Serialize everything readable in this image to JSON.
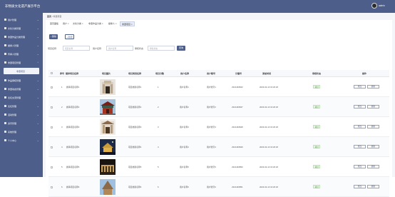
{
  "header": {
    "app_title": "非物质文化遗产展示平台",
    "username": "admin"
  },
  "sidebar": {
    "items": [
      {
        "label": "用户管理"
      },
      {
        "label": "文化分类管理"
      },
      {
        "label": "非遗作品分类管理"
      },
      {
        "label": "继承人管理"
      },
      {
        "label": "传承人管理"
      },
      {
        "label": "非遗项目管理"
      },
      {
        "label": "作品审核管理"
      },
      {
        "label": "非遗动态管理"
      },
      {
        "label": "论坛交流管理"
      },
      {
        "label": "论坛管理"
      },
      {
        "label": "活动管理"
      },
      {
        "label": "资讯管理"
      },
      {
        "label": "系统管理"
      },
      {
        "label": "个人中心"
      }
    ],
    "active_sub": "非遗项目"
  },
  "breadcrumb": {
    "home": "首页",
    "current": "非遗项目"
  },
  "tabs": [
    {
      "label": "首页面板"
    },
    {
      "label": "用户 ×"
    },
    {
      "label": "文化分类 ×"
    },
    {
      "label": "非遗作品分类 ×"
    },
    {
      "label": "继承人 ×"
    },
    {
      "label": "非遗项目 ×"
    }
  ],
  "toolbar": {
    "delete_label": "删除",
    "add_label": "新增"
  },
  "filters": {
    "name_label": "项目名称",
    "name_placeholder": "项目名称",
    "user_label": "用户名称",
    "user_placeholder": "用户名称",
    "status_label": "审核状态",
    "status_placeholder": "审核状态",
    "search_label": "查询"
  },
  "table": {
    "headers": [
      "序号",
      "继承项目名称",
      "项目图片",
      "项目类别名称",
      "项目分数",
      "用户名称",
      "用户账号",
      "分值号",
      "添加时间",
      "审核状态",
      "操作"
    ],
    "rows": [
      {
        "idx": "1",
        "name": "继承项目名称1",
        "category": "项目类别名称1",
        "score": "1",
        "user": "用户名称1",
        "account": "用户账号1",
        "code": "2321446843",
        "time": "2023-04-13 16:20:18",
        "status": "通过"
      },
      {
        "idx": "2",
        "name": "继承项目名称2",
        "category": "项目类别名称2",
        "score": "2",
        "user": "用户名称2",
        "account": "用户账号2",
        "code": "2321446847",
        "time": "2023-04-13 16:20:18",
        "status": "通过"
      },
      {
        "idx": "3",
        "name": "继承项目名称3",
        "category": "项目类别名称3",
        "score": "3",
        "user": "用户名称3",
        "account": "用户账号3",
        "code": "2321446848",
        "time": "2023-04-13 16:20:18",
        "status": "通过"
      },
      {
        "idx": "4",
        "name": "继承项目名称4",
        "category": "项目类别名称4",
        "score": "4",
        "user": "用户名称4",
        "account": "用户账号4",
        "code": "2321446849",
        "time": "2023-04-13 16:20:18",
        "status": "通过"
      },
      {
        "idx": "5",
        "name": "继承项目名称5",
        "category": "项目类别名称5",
        "score": "5",
        "user": "用户名称5",
        "account": "用户账号5",
        "code": "2321446850",
        "time": "2023-04-13 16:20:18",
        "status": "通过"
      },
      {
        "idx": "6",
        "name": "继承项目名称6",
        "category": "项目类别名称6",
        "score": "6",
        "user": "用户名称6",
        "account": "用户账号6",
        "code": "2321446851",
        "time": "2023-04-13 16:20:18",
        "status": "通过"
      }
    ],
    "edit_label": "修改",
    "delete_label": "删除"
  },
  "colors": {
    "accent": "#4e5e8a",
    "pass": "#4ba33a"
  }
}
